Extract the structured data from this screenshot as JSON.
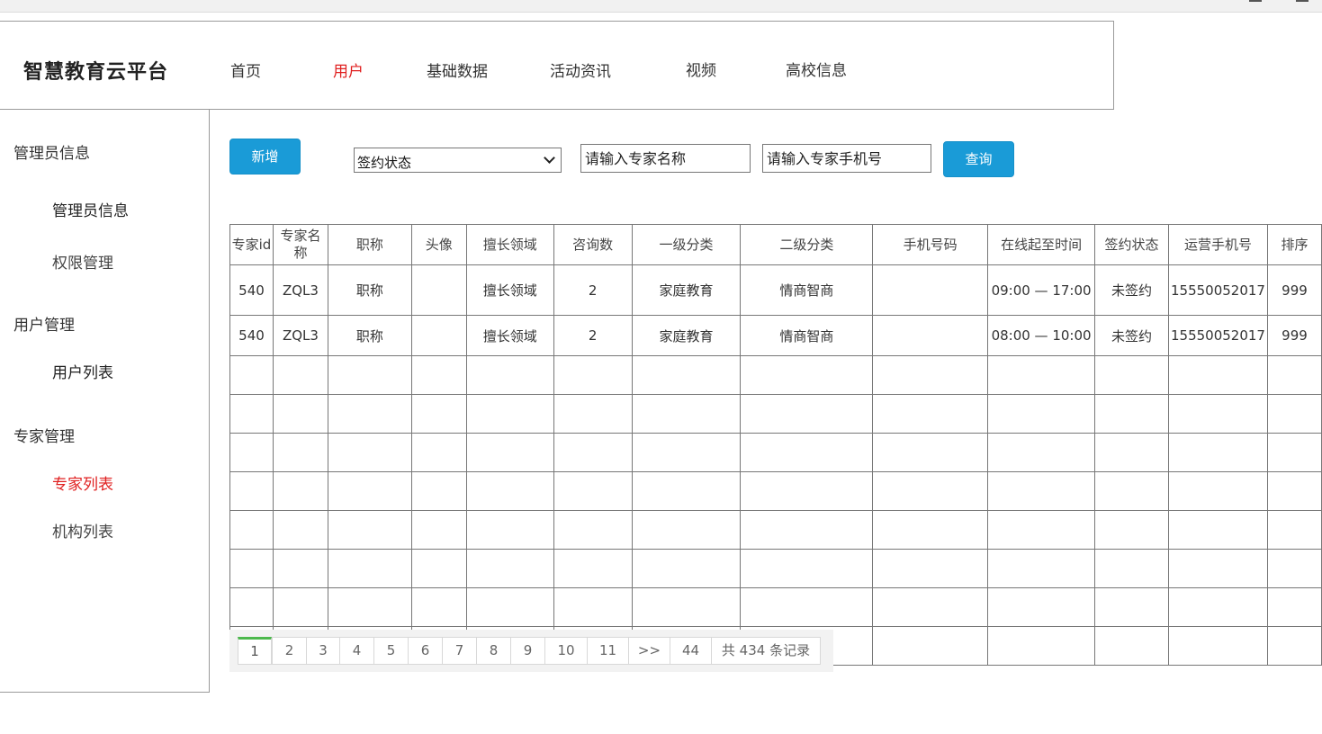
{
  "app": {
    "title": "智慧教育云平台"
  },
  "nav": [
    {
      "label": "首页",
      "active": false
    },
    {
      "label": "用户",
      "active": true
    },
    {
      "label": "基础数据",
      "active": false
    },
    {
      "label": "活动资讯",
      "active": false
    },
    {
      "label": "视频",
      "active": false
    },
    {
      "label": "高校信息",
      "active": false
    }
  ],
  "sidebar": {
    "groups": [
      {
        "label": "管理员信息",
        "items": [
          {
            "label": "管理员信息",
            "active": false
          },
          {
            "label": "权限管理",
            "active": false
          }
        ]
      },
      {
        "label": "用户管理",
        "items": [
          {
            "label": "用户列表",
            "active": false
          }
        ]
      },
      {
        "label": "专家管理",
        "items": [
          {
            "label": "专家列表",
            "active": true
          },
          {
            "label": "机构列表",
            "active": false
          }
        ]
      }
    ]
  },
  "toolbar": {
    "add_label": "新增",
    "status_select": "签约状态",
    "name_placeholder": "请输入专家名称",
    "phone_placeholder": "请输入专家手机号",
    "query_label": "查询"
  },
  "table": {
    "columns": [
      "专家id",
      "专家名称",
      "职称",
      "头像",
      "擅长领域",
      "咨询数",
      "一级分类",
      "二级分类",
      "手机号码",
      "在线起至时间",
      "签约状态",
      "运营手机号",
      "排序"
    ],
    "rows": [
      [
        "540",
        "ZQL3",
        "职称",
        "",
        "擅长领域",
        "2",
        "家庭教育",
        "情商智商",
        "",
        "09:00 — 17:00",
        "未签约",
        "15550052017",
        "999"
      ],
      [
        "540",
        "ZQL3",
        "职称",
        "",
        "擅长领域",
        "2",
        "家庭教育",
        "情商智商",
        "",
        "08:00 — 10:00",
        "未签约",
        "15550052017",
        "999"
      ]
    ]
  },
  "pagination": {
    "pages": [
      "1",
      "2",
      "3",
      "4",
      "5",
      "6",
      "7",
      "8",
      "9",
      "10",
      "11",
      ">>",
      "44"
    ],
    "current": "1",
    "total_label": "共 434 条记录"
  }
}
